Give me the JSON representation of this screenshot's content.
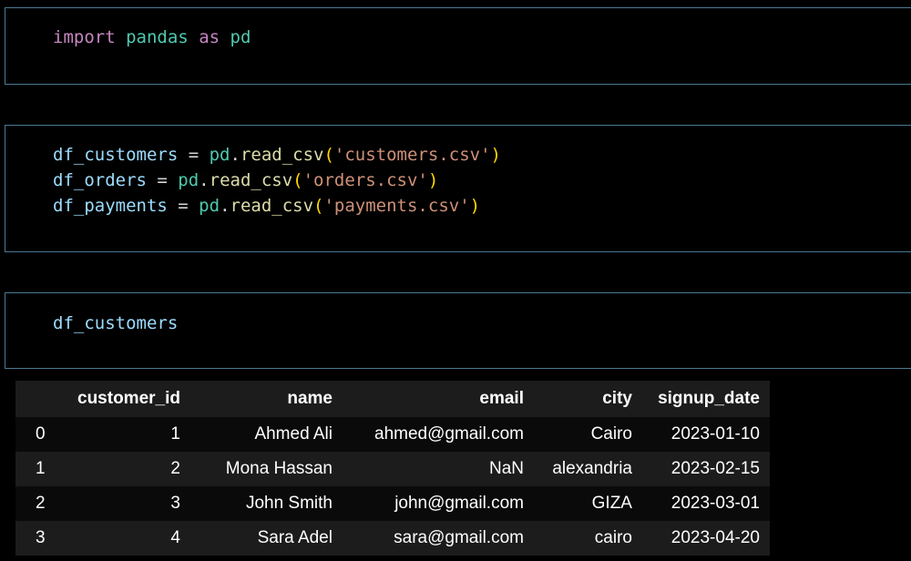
{
  "cells": [
    {
      "lines": [
        [
          {
            "t": "import",
            "c": "kw"
          },
          {
            "t": " ",
            "c": "op"
          },
          {
            "t": "pandas",
            "c": "mod"
          },
          {
            "t": " ",
            "c": "op"
          },
          {
            "t": "as",
            "c": "kw"
          },
          {
            "t": " ",
            "c": "op"
          },
          {
            "t": "pd",
            "c": "mod"
          }
        ]
      ]
    },
    {
      "lines": [
        [
          {
            "t": "df_customers",
            "c": "var"
          },
          {
            "t": " = ",
            "c": "op"
          },
          {
            "t": "pd",
            "c": "mod"
          },
          {
            "t": ".",
            "c": "op"
          },
          {
            "t": "read_csv",
            "c": "fn"
          },
          {
            "t": "(",
            "c": "paren"
          },
          {
            "t": "'customers.csv'",
            "c": "str"
          },
          {
            "t": ")",
            "c": "paren"
          }
        ],
        [
          {
            "t": "df_orders",
            "c": "var"
          },
          {
            "t": " = ",
            "c": "op"
          },
          {
            "t": "pd",
            "c": "mod"
          },
          {
            "t": ".",
            "c": "op"
          },
          {
            "t": "read_csv",
            "c": "fn"
          },
          {
            "t": "(",
            "c": "paren"
          },
          {
            "t": "'orders.csv'",
            "c": "str"
          },
          {
            "t": ")",
            "c": "paren"
          }
        ],
        [
          {
            "t": "df_payments",
            "c": "var"
          },
          {
            "t": " = ",
            "c": "op"
          },
          {
            "t": "pd",
            "c": "mod"
          },
          {
            "t": ".",
            "c": "op"
          },
          {
            "t": "read_csv",
            "c": "fn"
          },
          {
            "t": "(",
            "c": "paren"
          },
          {
            "t": "'payments.csv'",
            "c": "str"
          },
          {
            "t": ")",
            "c": "paren"
          }
        ]
      ]
    },
    {
      "lines": [
        [
          {
            "t": "df_customers",
            "c": "var"
          }
        ]
      ]
    }
  ],
  "output_table": {
    "columns": [
      "customer_id",
      "name",
      "email",
      "city",
      "signup_date"
    ],
    "rows": [
      {
        "index": "0",
        "customer_id": "1",
        "name": "Ahmed Ali",
        "email": "ahmed@gmail.com",
        "city": "Cairo",
        "signup_date": "2023-01-10"
      },
      {
        "index": "1",
        "customer_id": "2",
        "name": "Mona Hassan",
        "email": "NaN",
        "city": "alexandria",
        "signup_date": "2023-02-15"
      },
      {
        "index": "2",
        "customer_id": "3",
        "name": "John Smith",
        "email": "john@gmail.com",
        "city": "GIZA",
        "signup_date": "2023-03-01"
      },
      {
        "index": "3",
        "customer_id": "4",
        "name": "Sara Adel",
        "email": "sara@gmail.com",
        "city": "cairo",
        "signup_date": "2023-04-20"
      }
    ]
  },
  "colors": {
    "background": "#000000",
    "cell_border": "#4a7a92",
    "keyword": "#c586c0",
    "module": "#4ec9b0",
    "variable": "#9cdcfe",
    "function": "#dcdcaa",
    "paren": "#ffd700",
    "string": "#ce9178",
    "table_row_dark": "#0a0a0a",
    "table_row_light": "#1c1c1c"
  }
}
